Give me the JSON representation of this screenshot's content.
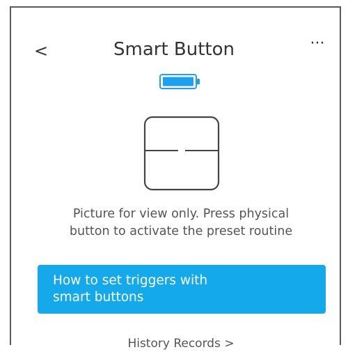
{
  "header": {
    "back_label": "<",
    "title": "Smart Button",
    "more_label": "···"
  },
  "battery": {
    "icon": "battery-icon",
    "color": "#1ea0f0"
  },
  "device": {
    "icon": "smart-button-device-icon"
  },
  "hint": {
    "line1": "Picture for view only. Press physical",
    "line2": "button to activate the preset routine"
  },
  "cta": {
    "line1": "How to set triggers with",
    "line2": "smart buttons",
    "color": "#13a9ea"
  },
  "history": {
    "label": "History Records >"
  }
}
